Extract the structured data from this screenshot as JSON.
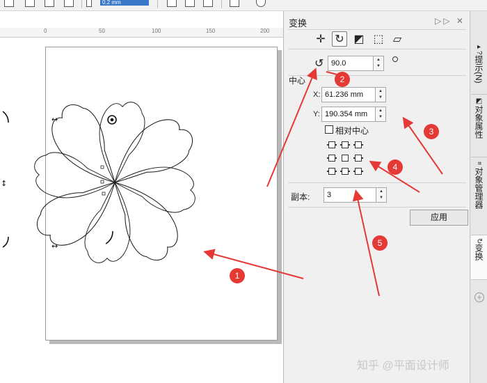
{
  "toolbar": {
    "size_value": "0.2 mm"
  },
  "ruler": {
    "ticks": [
      "0",
      "50",
      "100",
      "150",
      "200"
    ]
  },
  "docker": {
    "title": "变换",
    "controls": "▷▷ ✕",
    "tools": [
      {
        "name": "move-tool-icon",
        "glyph": "✛"
      },
      {
        "name": "rotate-tool-icon",
        "glyph": "↻"
      },
      {
        "name": "scale-mirror-tool-icon",
        "glyph": "◩"
      },
      {
        "name": "size-tool-icon",
        "glyph": "⬚"
      },
      {
        "name": "skew-tool-icon",
        "glyph": "▱"
      }
    ],
    "rotation_value": "90.0",
    "center_label": "中心",
    "x_label": "X:",
    "x_value": "61.236 mm",
    "y_label": "Y:",
    "y_value": "190.354 mm",
    "relative_center_label": "相对中心",
    "copies_label": "副本:",
    "copies_value": "3",
    "apply_label": "应用"
  },
  "side_tabs": [
    {
      "label": "提示(N)",
      "icon": "hint-icon"
    },
    {
      "label": "对象属性",
      "icon": "properties-icon"
    },
    {
      "label": "对象管理器",
      "icon": "object-manager-icon"
    },
    {
      "label": "变换",
      "icon": "transform-icon"
    }
  ],
  "annotations": [
    "1",
    "2",
    "3",
    "4",
    "5"
  ],
  "watermark": "知乎 @平面设计师",
  "colors": {
    "accent_red": "#e53935",
    "selection_blue": "#3a78c9",
    "panel_bg": "#f0f0f0"
  }
}
